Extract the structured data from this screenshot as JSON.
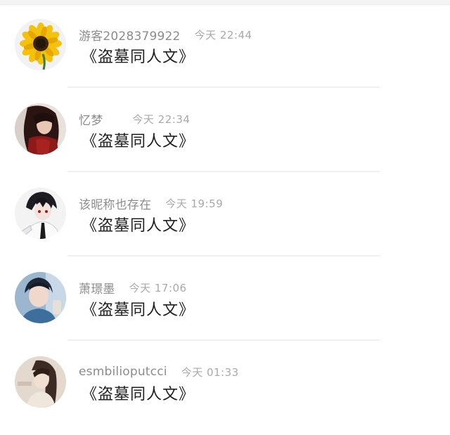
{
  "comments": [
    {
      "user": "游客2028379922",
      "time": "今天 22:44",
      "content": "《盗墓同人文》",
      "avatar_icon": "sunflower-avatar"
    },
    {
      "user": "忆梦",
      "time": "今天 22:34",
      "content": "《盗墓同人文》",
      "avatar_icon": "red-dress-girl-avatar"
    },
    {
      "user": "该昵称也存在",
      "time": "今天 19:59",
      "content": "《盗墓同人文》",
      "avatar_icon": "anime-boy-avatar"
    },
    {
      "user": "萧璟墨",
      "time": "今天 17:06",
      "content": "《盗墓同人文》",
      "avatar_icon": "blue-portrait-avatar"
    },
    {
      "user": "esmbilioputcci",
      "time": "今天 01:33",
      "content": "《盗墓同人文》",
      "avatar_icon": "beige-girl-avatar"
    }
  ],
  "colors": {
    "username": "#8c8c8c",
    "time": "#a9a9a9",
    "content": "#1f1f1f",
    "divider": "#f1f1f1"
  }
}
